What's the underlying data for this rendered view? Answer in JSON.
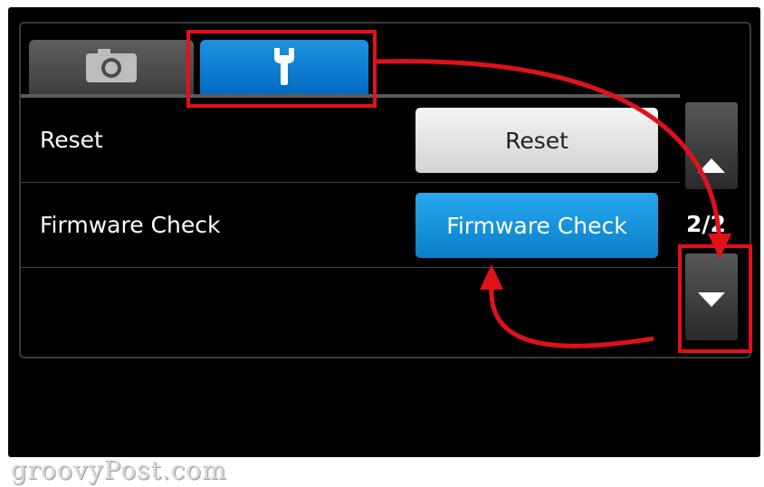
{
  "tabs": [
    {
      "icon": "camera-icon",
      "active": false
    },
    {
      "icon": "wrench-icon",
      "active": true
    }
  ],
  "settings": {
    "rows": [
      {
        "label": "Reset",
        "button": "Reset"
      },
      {
        "label": "Firmware Check",
        "button": "Firmware Check"
      }
    ]
  },
  "pager": {
    "indicator": "2/2"
  },
  "watermark": "groovyPost.com",
  "colors": {
    "active_tab": "#0a7fc9",
    "firmware_button": "#0a7fc9",
    "highlight": "#e1111a",
    "background": "#000000"
  }
}
